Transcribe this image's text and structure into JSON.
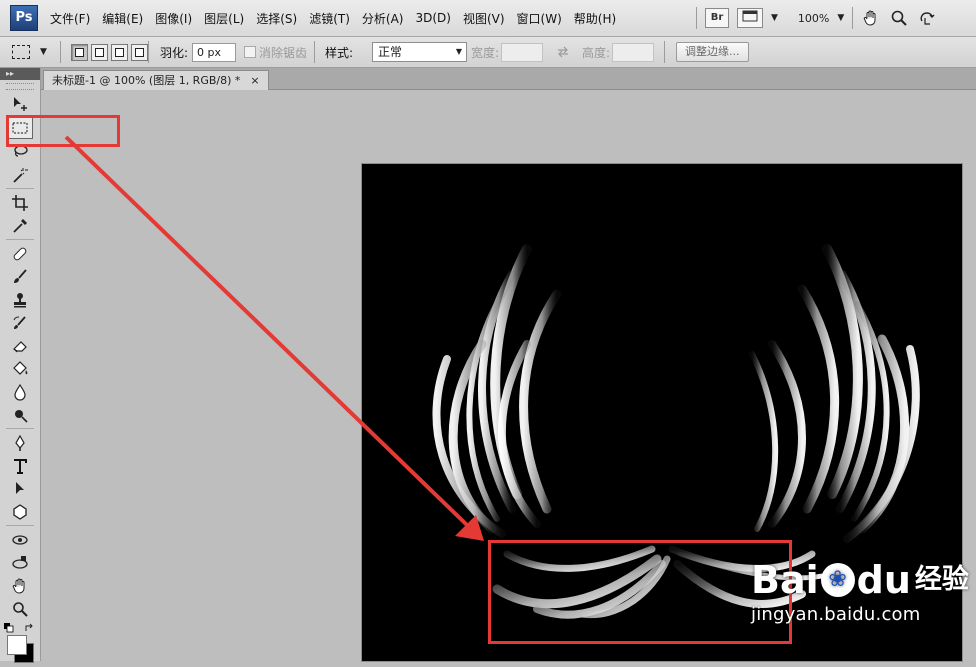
{
  "app": {
    "logo": "Ps"
  },
  "menu": [
    "文件(F)",
    "编辑(E)",
    "图像(I)",
    "图层(L)",
    "选择(S)",
    "滤镜(T)",
    "分析(A)",
    "3D(D)",
    "视图(V)",
    "窗口(W)",
    "帮助(H)"
  ],
  "menubar_right": {
    "bridge_label": "Br",
    "zoom": "100%"
  },
  "options_bar": {
    "feather_label": "羽化:",
    "feather_value": "0 px",
    "antialias_label": "消除锯齿",
    "style_label": "样式:",
    "style_value": "正常",
    "width_label": "宽度:",
    "height_label": "高度:",
    "refine_edge_button": "调整边缘..."
  },
  "document": {
    "tab_title": "未标题-1 @ 100% (图层 1, RGB/8) *",
    "close": "×"
  },
  "colors": {
    "annotation": "#e53935",
    "foreground": "#ffffff",
    "background": "#000000"
  },
  "watermark": {
    "brand": "Bai",
    "brand_tail": "du",
    "product": "经验",
    "url": "jingyan.baidu.com"
  }
}
